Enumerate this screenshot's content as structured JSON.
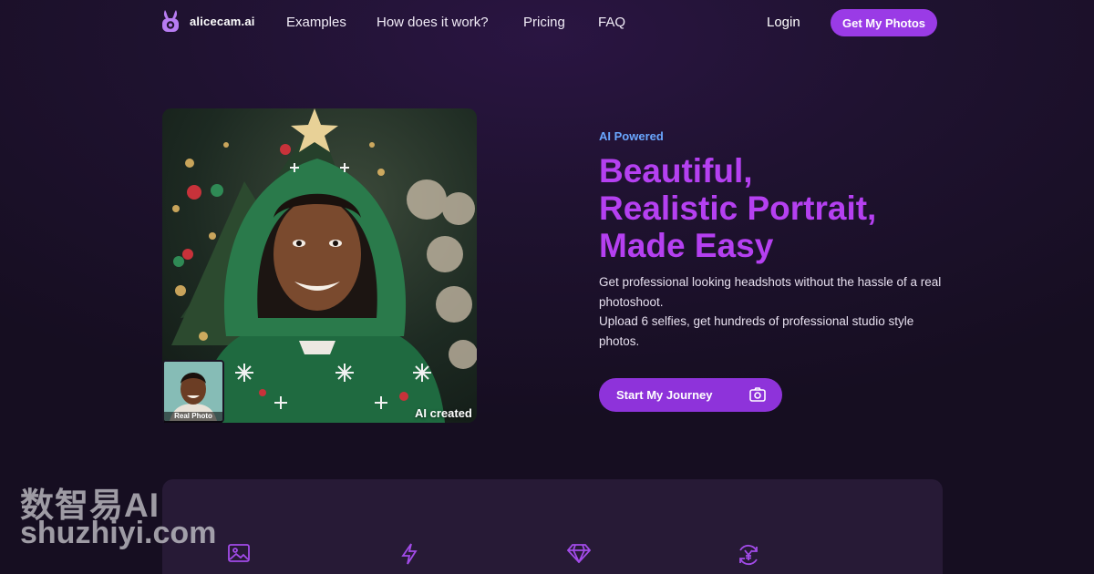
{
  "nav": {
    "logo_text": "alicecam.ai",
    "links": [
      "Examples",
      "How does it work?",
      "Pricing",
      "FAQ"
    ],
    "login": "Login",
    "cta": "Get My Photos"
  },
  "hero": {
    "eyebrow": "AI Powered",
    "headline_lines": [
      "Beautiful,",
      "Realistic Portrait,",
      "Made Easy"
    ],
    "description_lines": [
      "Get professional looking headshots without the hassle of a real photoshoot.",
      "Upload 6 selfies, get hundreds of professional studio style photos."
    ],
    "cta": "Start My Journey",
    "real_photo_label": "Real Photo",
    "ai_label": "AI created"
  },
  "features": {
    "icons": [
      "image-icon",
      "lightning-icon",
      "diamond-icon",
      "yen-refresh-icon"
    ]
  },
  "watermark": {
    "line1": "数智易AI",
    "line2": "shuzhiyi.com"
  },
  "colors": {
    "accent": "#9a3be6",
    "headline": "#b540f1",
    "eyebrow": "#6aa7ff",
    "background": "#1f1230"
  }
}
